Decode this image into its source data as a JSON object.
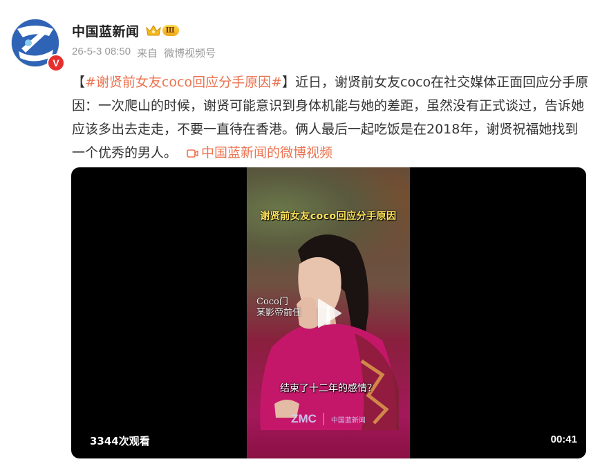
{
  "account": {
    "name": "中国蓝新闻",
    "vip_label": "Ⅲ",
    "avatar_badge": "V"
  },
  "meta": {
    "date": "26-5-3 08:50",
    "from_label": "来自",
    "source": "微博视频号"
  },
  "post": {
    "bracket_open": "【",
    "topic": "#谢贤前女友coco回应分手原因#",
    "bracket_close": "】",
    "body": "近日，谢贤前女友coco在社交媒体正面回应分手原因：一次爬山的时候，谢贤可能意识到身体机能与她的差距，虽然没有正式谈过，告诉她应该多出去走走，不要一直待在香港。俩人最后一起吃饭是在2018年，谢贤祝福她找到一个优秀的男人。",
    "video_link": "中国蓝新闻的微博视频"
  },
  "video": {
    "caption_top": "谢贤前女友coco回应分手原因",
    "name_tag_line1": "Coco门",
    "name_tag_line2": "某影帝前任",
    "caption_bottom": "结束了十二年的感情？",
    "logo_left": "ZMC",
    "logo_right": "中国蓝新闻",
    "views": "3344次观看",
    "duration": "00:41"
  },
  "colors": {
    "accent": "#eb7350",
    "meta_gray": "#999999",
    "avatar_blue": "#2b63b8",
    "badge_red": "#e62e2e",
    "caption_yellow": "#ffe25a"
  },
  "icons": {
    "vip": "crown-icon",
    "video_link": "video-camera-icon",
    "play": "play-icon",
    "avatar_badge": "verified-badge-icon"
  }
}
